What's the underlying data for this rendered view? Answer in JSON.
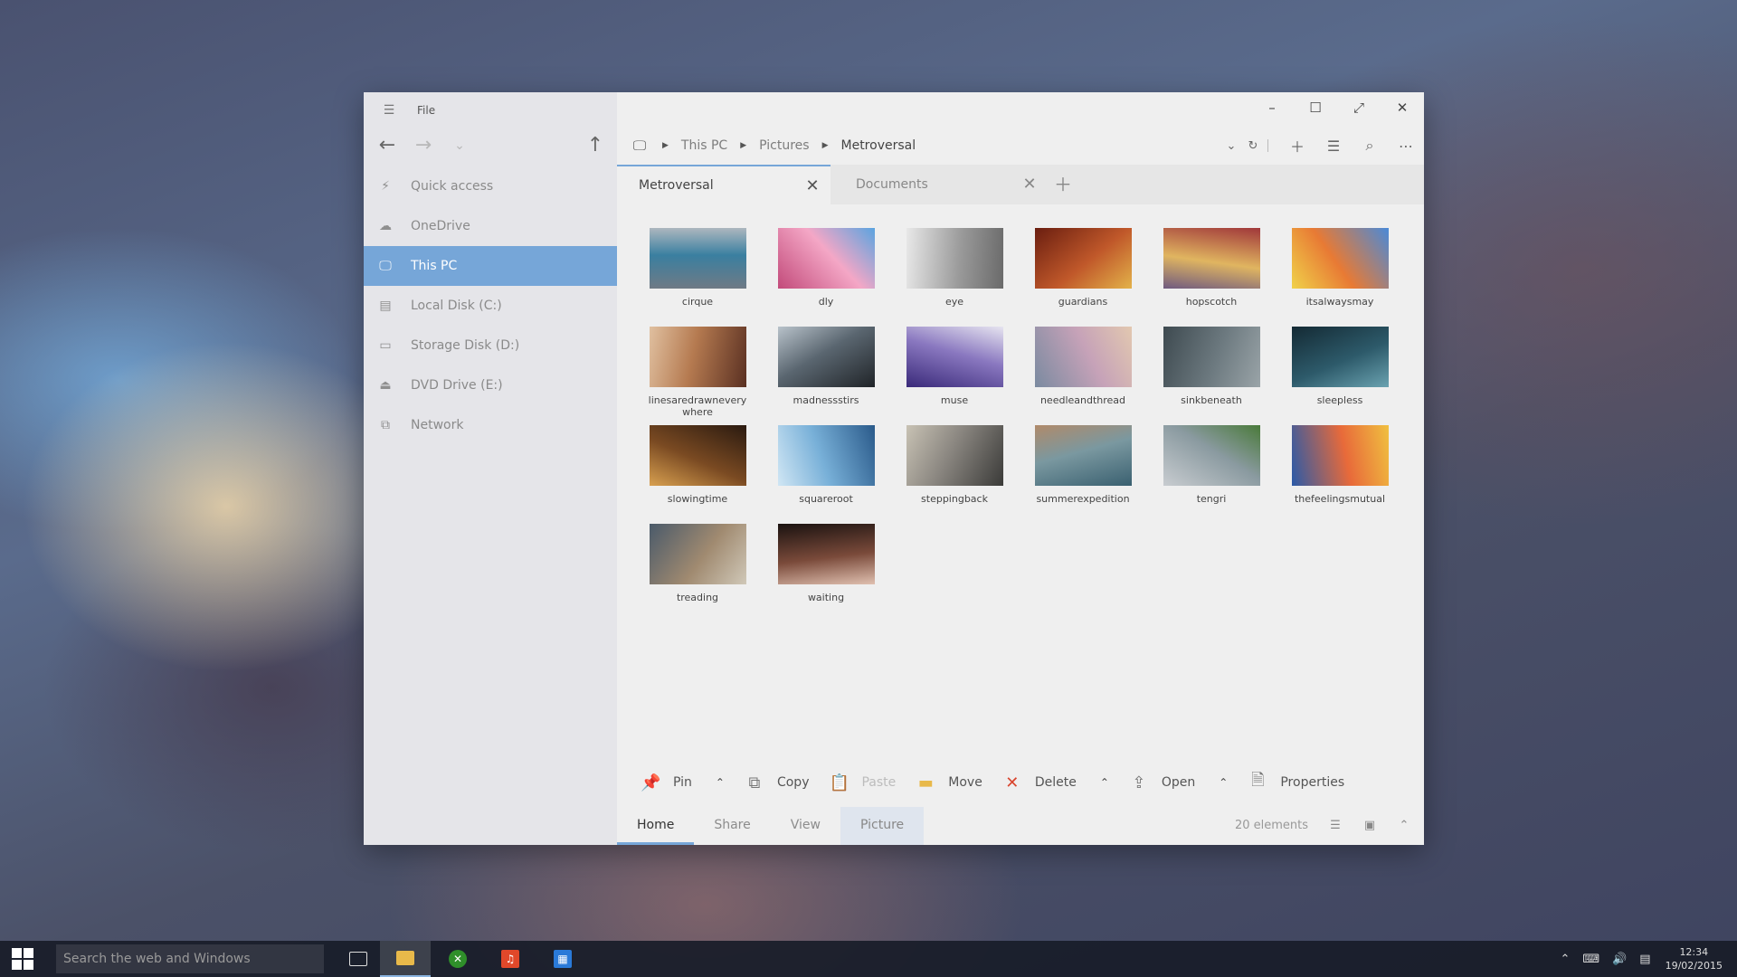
{
  "window": {
    "menu_label": "File",
    "controls": {
      "minimize": "–",
      "maximize": "☐",
      "fullscreen": "⤢",
      "close": "✕"
    }
  },
  "sidebar": {
    "items": [
      {
        "label": "Quick access",
        "icon": "quick-access-icon",
        "glyph": "⚡"
      },
      {
        "label": "OneDrive",
        "icon": "cloud-icon",
        "glyph": "☁"
      },
      {
        "label": "This PC",
        "icon": "computer-icon",
        "glyph": "🖵",
        "active": true
      },
      {
        "label": "Local Disk (C:)",
        "icon": "local-disk-icon",
        "glyph": "▤"
      },
      {
        "label": "Storage Disk (D:)",
        "icon": "storage-disk-icon",
        "glyph": "▭"
      },
      {
        "label": "DVD Drive (E:)",
        "icon": "dvd-drive-icon",
        "glyph": "⏏"
      },
      {
        "label": "Network",
        "icon": "network-icon",
        "glyph": "⧉"
      }
    ]
  },
  "breadcrumb": [
    "This PC",
    "Pictures",
    "Metroversal"
  ],
  "tabs": [
    {
      "label": "Metroversal",
      "active": true
    },
    {
      "label": "Documents",
      "active": false
    }
  ],
  "files": [
    {
      "name": "cirque",
      "colors": [
        "#6f7a85",
        "#3a7fa0",
        "#adb7bf"
      ]
    },
    {
      "name": "dly",
      "colors": [
        "#c24a7a",
        "#f4a7c6",
        "#5aa4e0"
      ]
    },
    {
      "name": "eye",
      "colors": [
        "#e8e8e8",
        "#9a9a9a",
        "#6a6a6a"
      ]
    },
    {
      "name": "guardians",
      "colors": [
        "#6a1e10",
        "#c0582a",
        "#e3b24a"
      ]
    },
    {
      "name": "hopscotch",
      "colors": [
        "#a0373a",
        "#e0b560",
        "#6f5a80"
      ]
    },
    {
      "name": "itsalwaysmay",
      "colors": [
        "#4a8ad8",
        "#e87a34",
        "#f0d24a"
      ]
    },
    {
      "name": "linesaredrawneverywhere",
      "colors": [
        "#5a3022",
        "#b57a50",
        "#e0c0a0"
      ]
    },
    {
      "name": "madnessstirs",
      "colors": [
        "#202428",
        "#5a6670",
        "#b8c2ca"
      ]
    },
    {
      "name": "muse",
      "colors": [
        "#3a2a7a",
        "#8a78c0",
        "#e6e4f0"
      ]
    },
    {
      "name": "needleandthread",
      "colors": [
        "#7a8aa0",
        "#c6a2b8",
        "#e2c8b0"
      ]
    },
    {
      "name": "sinkbeneath",
      "colors": [
        "#3e4a50",
        "#6d7a80",
        "#9aa4a8"
      ]
    },
    {
      "name": "sleepless",
      "colors": [
        "#142a34",
        "#2d5a6a",
        "#6aa2b0"
      ]
    },
    {
      "name": "slowingtime",
      "colors": [
        "#2a1a10",
        "#7a4a22",
        "#d8a050"
      ]
    },
    {
      "name": "squareroot",
      "colors": [
        "#2a5a8a",
        "#78b0d8",
        "#d0e6f4"
      ]
    },
    {
      "name": "steppingback",
      "colors": [
        "#3a3a38",
        "#8a8680",
        "#c8c2b4"
      ]
    },
    {
      "name": "summerexpedition",
      "colors": [
        "#3a6070",
        "#7a98a0",
        "#b08a6a"
      ]
    },
    {
      "name": "tengri",
      "colors": [
        "#c8ccd0",
        "#8a9aa0",
        "#4a7a3a"
      ]
    },
    {
      "name": "thefeelingsmutual",
      "colors": [
        "#2a5aa8",
        "#e86a3a",
        "#f0c040"
      ]
    },
    {
      "name": "treading",
      "colors": [
        "#4a5a6a",
        "#a08a70",
        "#d0c8b8"
      ]
    },
    {
      "name": "waiting",
      "colors": [
        "#1a1210",
        "#7a4a3a",
        "#e0c0b0"
      ]
    }
  ],
  "ribbon": {
    "pin": "Pin",
    "copy": "Copy",
    "paste": "Paste",
    "move": "Move",
    "delete": "Delete",
    "open": "Open",
    "properties": "Properties"
  },
  "bottom_tabs": [
    "Home",
    "Share",
    "View",
    "Picture"
  ],
  "status": "20 elements",
  "taskbar": {
    "search_placeholder": "Search the web and Windows",
    "time": "12:34",
    "date": "19/02/2015"
  }
}
